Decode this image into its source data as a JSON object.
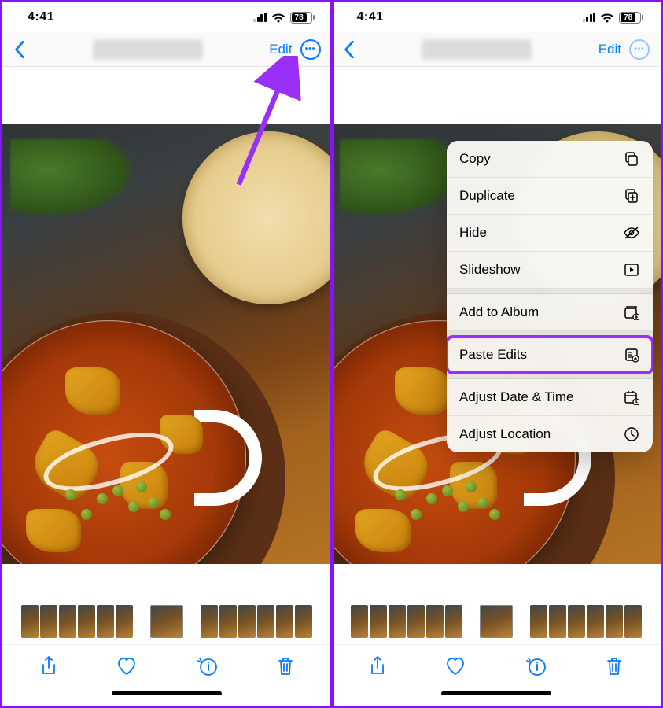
{
  "status": {
    "time": "4:41",
    "battery": "78"
  },
  "nav": {
    "edit_label": "Edit"
  },
  "toolbar": {
    "share": "share",
    "favorite": "favorite",
    "info": "info",
    "delete": "delete"
  },
  "menu": {
    "items": [
      {
        "label": "Copy",
        "icon": "copy"
      },
      {
        "label": "Duplicate",
        "icon": "duplicate"
      },
      {
        "label": "Hide",
        "icon": "hide"
      },
      {
        "label": "Slideshow",
        "icon": "slideshow"
      }
    ],
    "items2": [
      {
        "label": "Add to Album",
        "icon": "album"
      }
    ],
    "items3": [
      {
        "label": "Paste Edits",
        "icon": "paste-edits",
        "highlight": true
      }
    ],
    "items4": [
      {
        "label": "Adjust Date & Time",
        "icon": "calendar"
      },
      {
        "label": "Adjust Location",
        "icon": "location"
      }
    ]
  }
}
